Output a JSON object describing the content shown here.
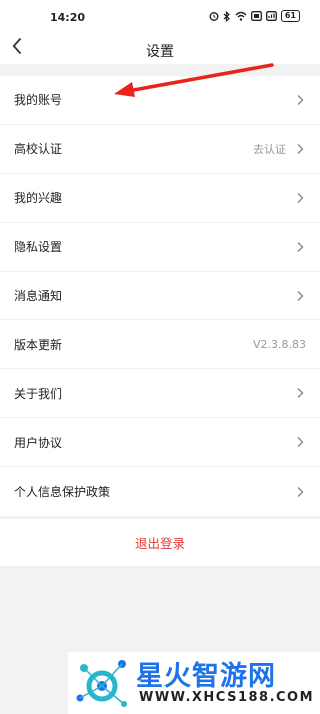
{
  "status_bar": {
    "time": "14:20",
    "battery": "61"
  },
  "header": {
    "back_icon": "chevron-left-icon",
    "title": "设置"
  },
  "settings": [
    {
      "label": "我的账号",
      "value": ""
    },
    {
      "label": "高校认证",
      "value": "去认证"
    },
    {
      "label": "我的兴趣",
      "value": ""
    },
    {
      "label": "隐私设置",
      "value": ""
    },
    {
      "label": "消息通知",
      "value": ""
    },
    {
      "label": "版本更新",
      "value": "V2.3.8.83"
    },
    {
      "label": "关于我们",
      "value": ""
    },
    {
      "label": "用户协议",
      "value": ""
    },
    {
      "label": "个人信息保护政策",
      "value": ""
    }
  ],
  "logout_label": "退出登录",
  "watermark": {
    "brand": "星火智游网",
    "url": "WWW.XHCS188.COM"
  },
  "colors": {
    "accent_red": "#e53935",
    "watermark_blue": "#1e73e8"
  }
}
